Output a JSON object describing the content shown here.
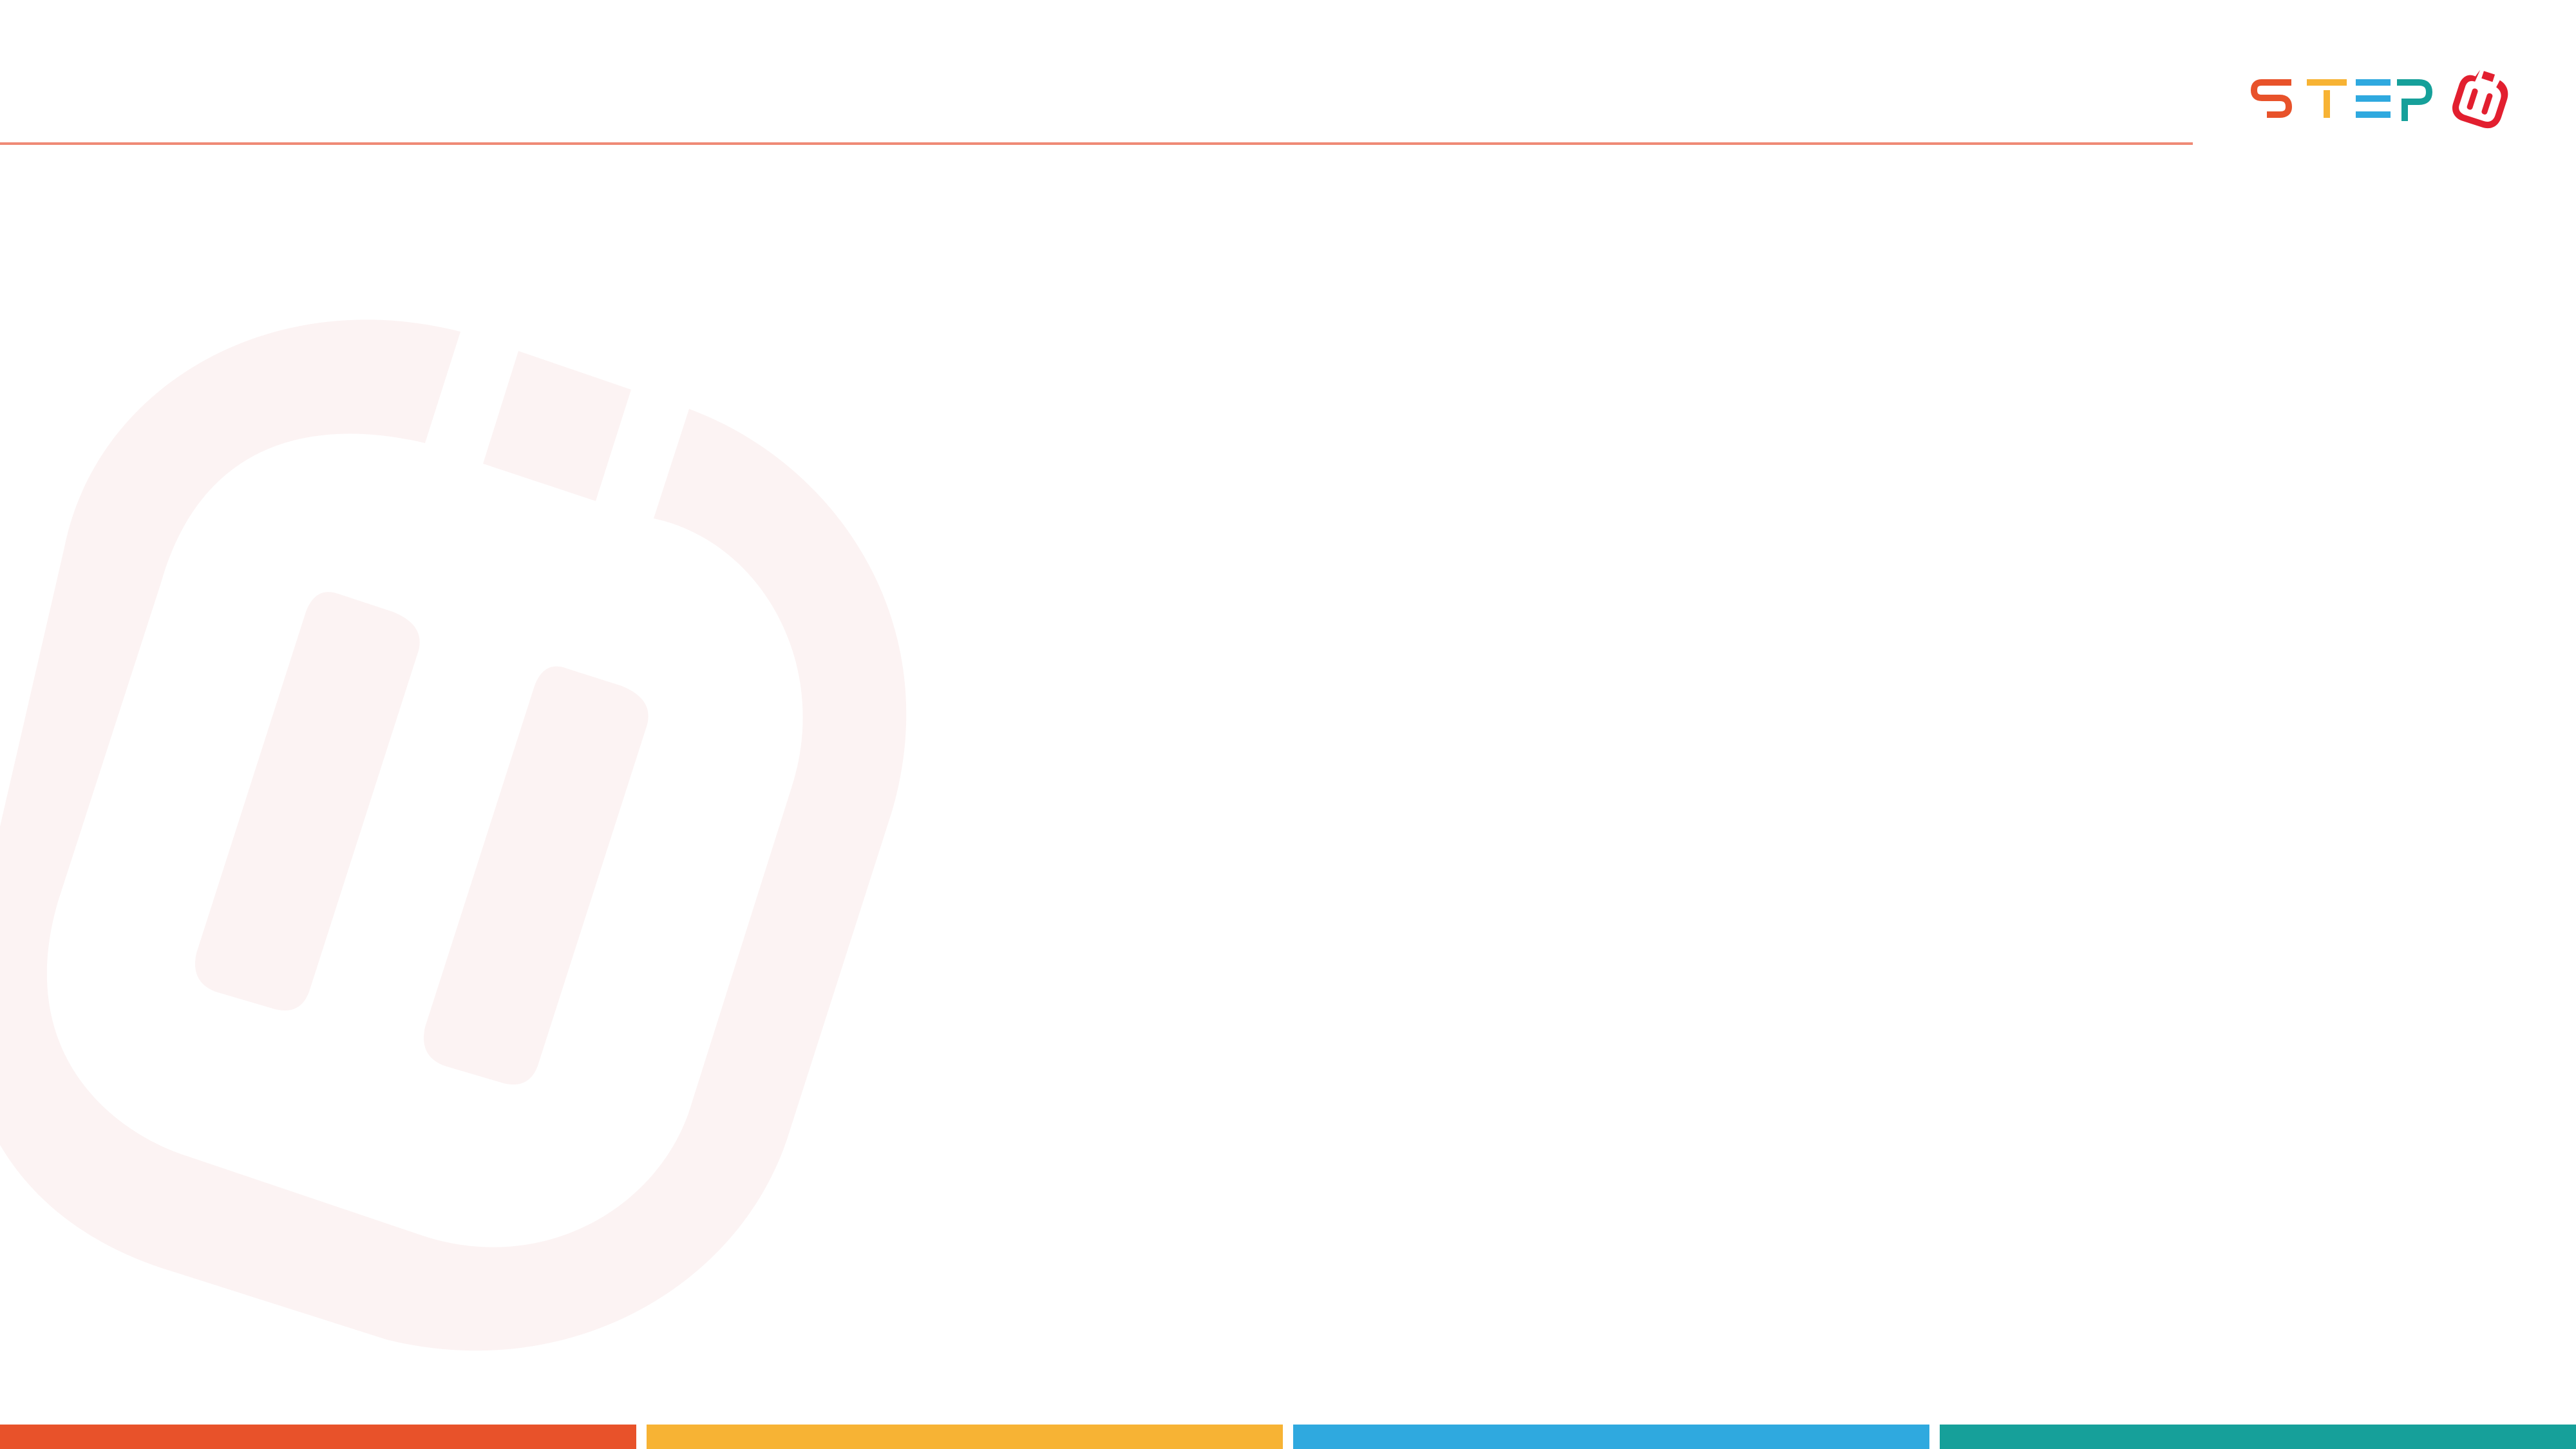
{
  "logo": {
    "text": "STEP",
    "icon": "step-bag-icon",
    "colors": {
      "s": "#e8522a",
      "t": "#f7b334",
      "e": "#2fa9df",
      "p": "#16a09a",
      "icon": "#e21f2f"
    }
  },
  "header": {
    "rule_color": "#ef8a76"
  },
  "watermark": {
    "icon": "step-bag-icon",
    "color": "#fcf3f3"
  },
  "footer": {
    "bar_colors": [
      "#e8522a",
      "#f7b334",
      "#2fa9df",
      "#16a09a"
    ]
  }
}
